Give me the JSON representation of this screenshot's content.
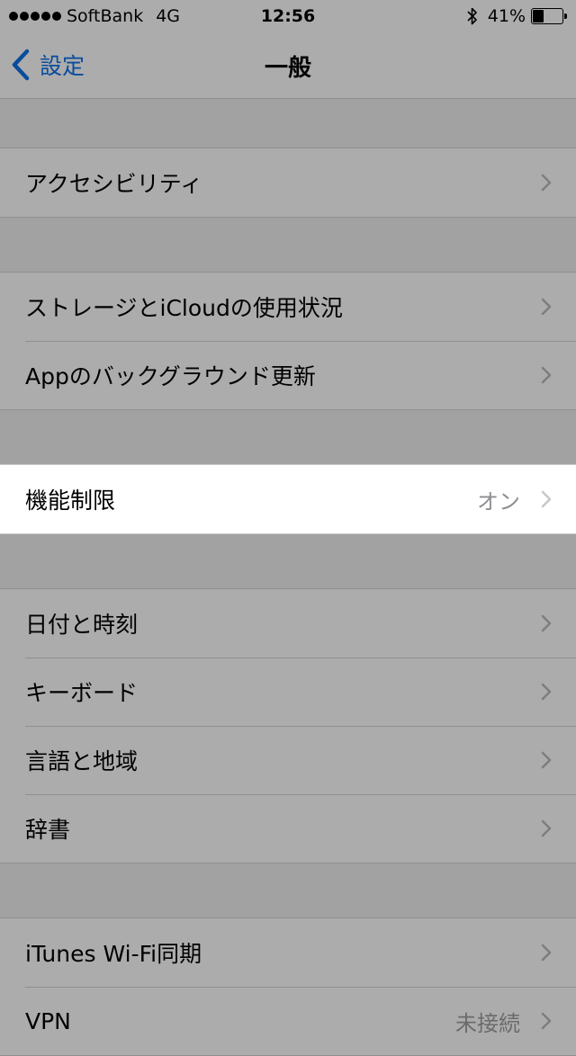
{
  "status_bar": {
    "carrier": "SoftBank",
    "network": "4G",
    "time": "12:56",
    "battery_percent": "41%",
    "battery_level": 0.41,
    "signal_icon": "signal-dots-icon",
    "bluetooth_icon": "bluetooth-icon",
    "battery_icon": "battery-icon"
  },
  "nav": {
    "back_label": "設定",
    "title": "一般",
    "back_icon": "chevron-left-icon"
  },
  "colors": {
    "accent": "#0a4c9c",
    "dim_background": "#a2a2a2",
    "highlight_background": "#ffffff"
  },
  "groups": [
    {
      "rows": [
        {
          "label": "アクセシビリティ",
          "value": ""
        }
      ]
    },
    {
      "rows": [
        {
          "label": "ストレージとiCloudの使用状況",
          "value": ""
        },
        {
          "label": "Appのバックグラウンド更新",
          "value": ""
        }
      ]
    },
    {
      "highlighted": true,
      "rows": [
        {
          "label": "機能制限",
          "value": "オン"
        }
      ]
    },
    {
      "rows": [
        {
          "label": "日付と時刻",
          "value": ""
        },
        {
          "label": "キーボード",
          "value": ""
        },
        {
          "label": "言語と地域",
          "value": ""
        },
        {
          "label": "辞書",
          "value": ""
        }
      ]
    },
    {
      "rows": [
        {
          "label": "iTunes Wi-Fi同期",
          "value": ""
        },
        {
          "label": "VPN",
          "value": "未接続"
        }
      ]
    }
  ]
}
